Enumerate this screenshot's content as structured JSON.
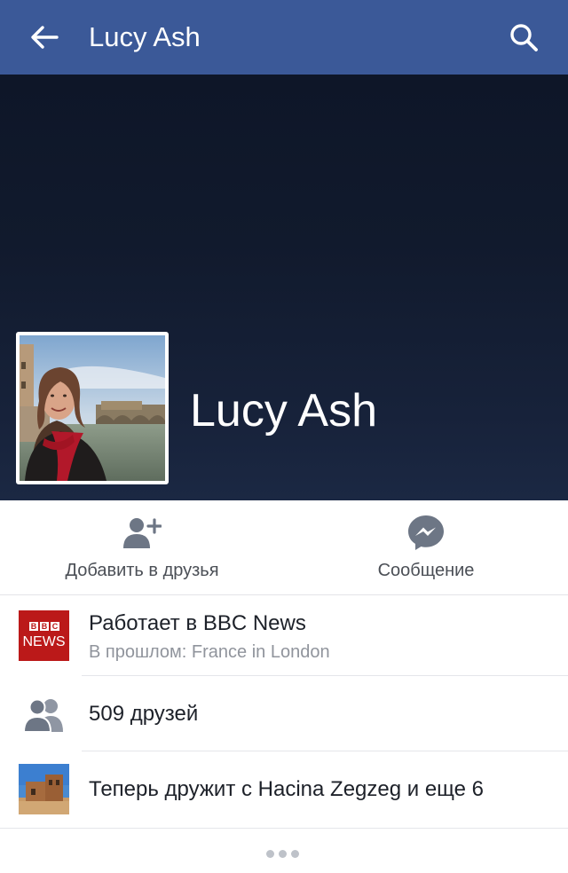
{
  "topbar": {
    "title": "Lucy Ash",
    "back_icon": "arrow-left-icon",
    "search_icon": "search-icon",
    "background": "#3b5998"
  },
  "profile": {
    "name": "Lucy Ash"
  },
  "actions": [
    {
      "label": "Добавить в друзья",
      "icon": "add-friend-icon"
    },
    {
      "label": "Сообщение",
      "icon": "messenger-icon"
    }
  ],
  "info": {
    "work": {
      "title": "Работает в BBC News",
      "subtitle": "В прошлом: France in London",
      "logo_blocks": [
        "B",
        "B",
        "C"
      ],
      "logo_text": "NEWS",
      "logo_color": "#bb1919"
    },
    "friends": {
      "text": "509 друзей",
      "icon": "friends-icon"
    },
    "new_friends": {
      "text": "Теперь дружит с Hacina Zegzeg и еще 6"
    }
  },
  "more_icon": "more-dots-icon"
}
